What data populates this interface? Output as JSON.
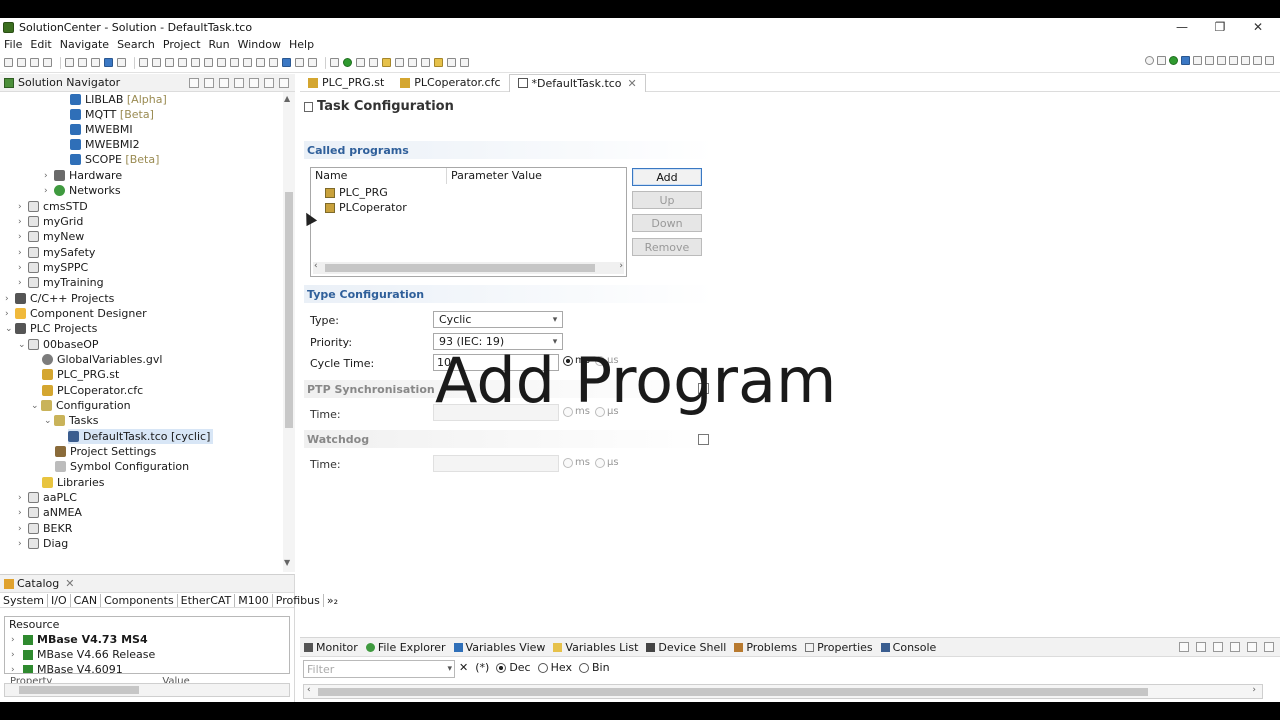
{
  "window": {
    "title": "SolutionCenter - Solution - DefaultTask.tco",
    "minimize": "—",
    "maximize": "❐",
    "close": "✕"
  },
  "menu": [
    "File",
    "Edit",
    "Navigate",
    "Search",
    "Project",
    "Run",
    "Window",
    "Help"
  ],
  "navigator": {
    "title": "Solution Navigator",
    "tree": [
      {
        "label": "LIBLAB",
        "tag": "[Alpha]",
        "icon": "library-icon"
      },
      {
        "label": "MQTT",
        "tag": "[Beta]",
        "icon": "library-icon"
      },
      {
        "label": "MWEBMI",
        "tag": "",
        "icon": "library-icon"
      },
      {
        "label": "MWEBMI2",
        "tag": "",
        "icon": "library-icon"
      },
      {
        "label": "SCOPE",
        "tag": "[Beta]",
        "icon": "library-icon"
      },
      {
        "label": "Hardware",
        "tag": "",
        "icon": "hardware-icon"
      },
      {
        "label": "Networks",
        "tag": "",
        "icon": "network-icon"
      },
      {
        "label": "cmsSTD",
        "tag": "",
        "icon": "project-icon"
      },
      {
        "label": "myGrid",
        "tag": "",
        "icon": "project-icon"
      },
      {
        "label": "myNew",
        "tag": "",
        "icon": "project-icon"
      },
      {
        "label": "mySafety",
        "tag": "",
        "icon": "project-icon"
      },
      {
        "label": "mySPPC",
        "tag": "",
        "icon": "project-icon"
      },
      {
        "label": "myTraining",
        "tag": "",
        "icon": "project-icon"
      },
      {
        "label": "C/C++ Projects",
        "tag": "",
        "icon": "c-projects-icon"
      },
      {
        "label": "Component Designer",
        "tag": "",
        "icon": "component-designer-icon"
      },
      {
        "label": "PLC Projects",
        "tag": "",
        "icon": "plc-icon"
      },
      {
        "label": "00baseOP",
        "tag": "",
        "icon": "project-icon"
      },
      {
        "label": "GlobalVariables.gvl",
        "tag": "",
        "icon": "globe-icon"
      },
      {
        "label": "PLC_PRG.st",
        "tag": "",
        "icon": "program-icon"
      },
      {
        "label": "PLCoperator.cfc",
        "tag": "",
        "icon": "program-icon"
      },
      {
        "label": "Configuration",
        "tag": "",
        "icon": "folder-icon"
      },
      {
        "label": "Tasks",
        "tag": "",
        "icon": "folder-icon"
      },
      {
        "label": "DefaultTask.tco [cyclic]",
        "tag": "",
        "icon": "task-icon"
      },
      {
        "label": "Project Settings",
        "tag": "",
        "icon": "wrench-icon"
      },
      {
        "label": "Symbol Configuration",
        "tag": "",
        "icon": "symbol-icon"
      },
      {
        "label": "Libraries",
        "tag": "",
        "icon": "libraries-icon"
      },
      {
        "label": "aaPLC",
        "tag": "",
        "icon": "project-icon"
      },
      {
        "label": "aNMEA",
        "tag": "",
        "icon": "project-icon"
      },
      {
        "label": "BEKR",
        "tag": "",
        "icon": "project-icon"
      },
      {
        "label": "Diag",
        "tag": "",
        "icon": "project-icon"
      }
    ]
  },
  "catalog": {
    "title": "Catalog",
    "tabs": [
      "System",
      "I/O",
      "CAN",
      "Components",
      "EtherCAT",
      "M100",
      "Profibus",
      "»₂"
    ],
    "header": "Resource",
    "items": [
      "MBase V4.73 MS4",
      "MBase V4.66 Release",
      "MBase V4.6091"
    ],
    "footer_cols": [
      "Property",
      "Value"
    ]
  },
  "editor": {
    "tabs": [
      {
        "label": "PLC_PRG.st"
      },
      {
        "label": "PLCoperator.cfc"
      },
      {
        "label": "*DefaultTask.tco"
      }
    ],
    "title": "Task Configuration",
    "called_programs": {
      "section": "Called programs",
      "columns": [
        "Name",
        "Parameter Value"
      ],
      "rows": [
        "PLC_PRG",
        "PLCoperator"
      ],
      "buttons": {
        "add": "Add",
        "up": "Up",
        "down": "Down",
        "remove": "Remove"
      }
    },
    "type_config": {
      "section": "Type Configuration",
      "type_label": "Type:",
      "type_value": "Cyclic",
      "priority_label": "Priority:",
      "priority_value": "93  (IEC:  19)",
      "cycle_label": "Cycle Time:",
      "cycle_value": "10",
      "unit_ms": "ms",
      "unit_us": "μs"
    },
    "ptp": {
      "section": "PTP Synchronisation",
      "time_label": "Time:",
      "unit_ms": "ms",
      "unit_us": "μs"
    },
    "watchdog": {
      "section": "Watchdog",
      "time_label": "Time:",
      "unit_ms": "ms",
      "unit_us": "μs"
    },
    "overlay_caption": "Add Program"
  },
  "bottom": {
    "tabs": [
      "Monitor",
      "File Explorer",
      "Variables View",
      "Variables List",
      "Device Shell",
      "Problems",
      "Properties",
      "Console"
    ],
    "filter_placeholder": "Filter",
    "options": {
      "hex_prefix": "(*)",
      "dec": "Dec",
      "hex": "Hex",
      "bin": "Bin"
    }
  }
}
